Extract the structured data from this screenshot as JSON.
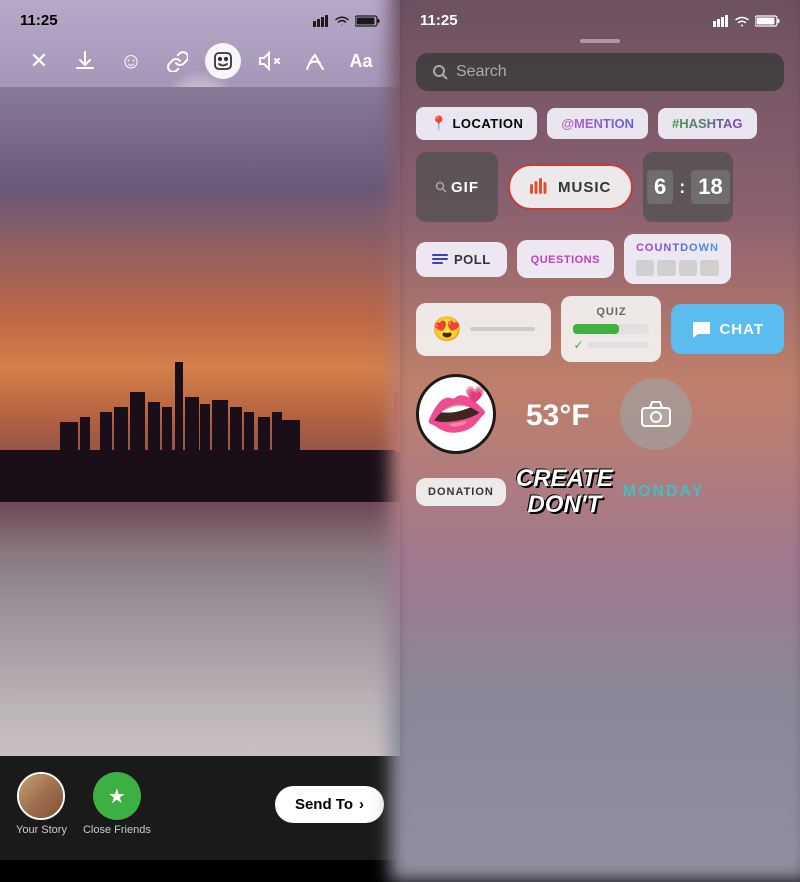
{
  "left": {
    "statusBar": {
      "time": "11:25"
    },
    "toolbar": {
      "closeIcon": "✕",
      "downloadIcon": "⬇",
      "stickerIcon": "☺",
      "linkIcon": "🔗",
      "activeIcon": "◻",
      "muteIcon": "🔇",
      "drawIcon": "〰",
      "textIcon": "Aa"
    },
    "bottomBar": {
      "yourStoryLabel": "Your Story",
      "closeFriendsLabel": "Close Friends",
      "sendToLabel": "Send To",
      "sendArrow": "›"
    }
  },
  "right": {
    "statusBar": {
      "time": "11:25"
    },
    "search": {
      "placeholder": "Search"
    },
    "stickers": {
      "row1": [
        {
          "id": "location",
          "icon": "📍",
          "label": "LOCATION"
        },
        {
          "id": "mention",
          "label": "@MENTION"
        },
        {
          "id": "hashtag",
          "label": "#HASHTAG"
        }
      ],
      "row2": {
        "gif": "GIF",
        "music": "MUSIC",
        "timer": {
          "digit1": "6",
          "digit2": "18"
        }
      },
      "row3": {
        "poll": "POLL",
        "questions": "QUESTIONS",
        "countdown": "COUNTDOWN"
      },
      "row4": {
        "emoji": "😍",
        "quizLabel": "QUIZ",
        "chat": "CHAT"
      },
      "row5": {
        "temperature": "53°F"
      },
      "row6": {
        "donation": "DONATION",
        "createDont": "CREATE\nDON'T",
        "monday": "MONDAY"
      }
    }
  }
}
